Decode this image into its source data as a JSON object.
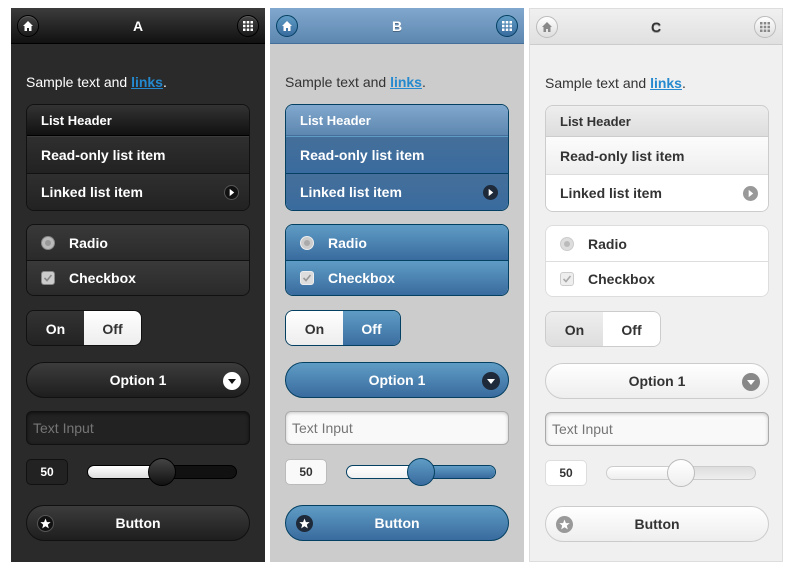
{
  "panels": {
    "a": {
      "title": "A",
      "sample_text": "Sample text and ",
      "link_text": "links",
      "sample_suffix": ".",
      "list_header": "List Header",
      "readonly_item": "Read-only list item",
      "linked_item": "Linked list item",
      "radio_label": "Radio",
      "checkbox_label": "Checkbox",
      "flip_on": "On",
      "flip_off": "Off",
      "flip_state": "off",
      "select_value": "Option 1",
      "text_input_placeholder": "Text Input",
      "slider_value": "50",
      "slider_level": 0.5,
      "button_label": "Button"
    },
    "b": {
      "title": "B",
      "sample_text": "Sample text and ",
      "link_text": "links",
      "sample_suffix": ".",
      "list_header": "List Header",
      "readonly_item": "Read-only list item",
      "linked_item": "Linked list item",
      "radio_label": "Radio",
      "checkbox_label": "Checkbox",
      "flip_on": "On",
      "flip_off": "Off",
      "flip_state": "off",
      "select_value": "Option 1",
      "text_input_placeholder": "Text Input",
      "slider_value": "50",
      "slider_level": 0.5,
      "button_label": "Button"
    },
    "c": {
      "title": "C",
      "sample_text": "Sample text and ",
      "link_text": "links",
      "sample_suffix": ".",
      "list_header": "List Header",
      "readonly_item": "Read-only list item",
      "linked_item": "Linked list item",
      "radio_label": "Radio",
      "checkbox_label": "Checkbox",
      "flip_on": "On",
      "flip_off": "Off",
      "flip_state": "on",
      "select_value": "Option 1",
      "text_input_placeholder": "Text Input",
      "slider_value": "50",
      "slider_level": 0.5,
      "button_label": "Button"
    }
  },
  "icons": {
    "home": "home-icon",
    "grid": "grid-icon",
    "arrow_right": "arrow-right-icon",
    "arrow_down": "arrow-down-icon",
    "star": "star-icon",
    "radio": "radio-icon",
    "checkbox": "checkbox-icon"
  },
  "colors": {
    "theme_a_bg": "#2a2a2a",
    "theme_b_bg": "#cccccc",
    "theme_b_accent": "#396b9e",
    "theme_c_bg": "#f0f0f0",
    "link": "#2489ce"
  }
}
